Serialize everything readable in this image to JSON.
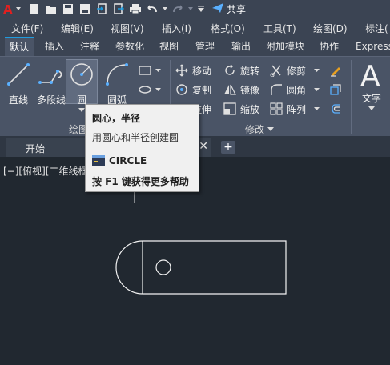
{
  "quick_access": {
    "share_label": "共享"
  },
  "menu": {
    "items": [
      "文件(F)",
      "编辑(E)",
      "视图(V)",
      "插入(I)",
      "格式(O)",
      "工具(T)",
      "绘图(D)",
      "标注("
    ]
  },
  "ribbon_tabs": {
    "items": [
      "默认",
      "插入",
      "注释",
      "参数化",
      "视图",
      "管理",
      "输出",
      "附加模块",
      "协作",
      "Express"
    ],
    "active": "默认"
  },
  "draw_panel": {
    "line": "直线",
    "polyline": "多段线",
    "circle": "圆",
    "arc": "圆弧",
    "panel_label": "绘图"
  },
  "modify_panel": {
    "move": "移动",
    "rotate": "旋转",
    "trim": "修剪",
    "copy": "复制",
    "mirror": "镜像",
    "fillet": "圆角",
    "stretch": "拉伸",
    "scale": "缩放",
    "array": "阵列",
    "panel_label": "修改"
  },
  "annotation_panel": {
    "text": "文字"
  },
  "document_tab": {
    "title": "开始"
  },
  "viewport": {
    "label": "[−][俯视][二维线框"
  },
  "tooltip": {
    "title": "圆心，半径",
    "description": "用圆心和半径创建圆",
    "command": "CIRCLE",
    "help": "按 F1 键获得更多帮助"
  },
  "colors": {
    "accent": "#1f9bde",
    "background": "#212830",
    "ribbon": "#4a5466"
  }
}
